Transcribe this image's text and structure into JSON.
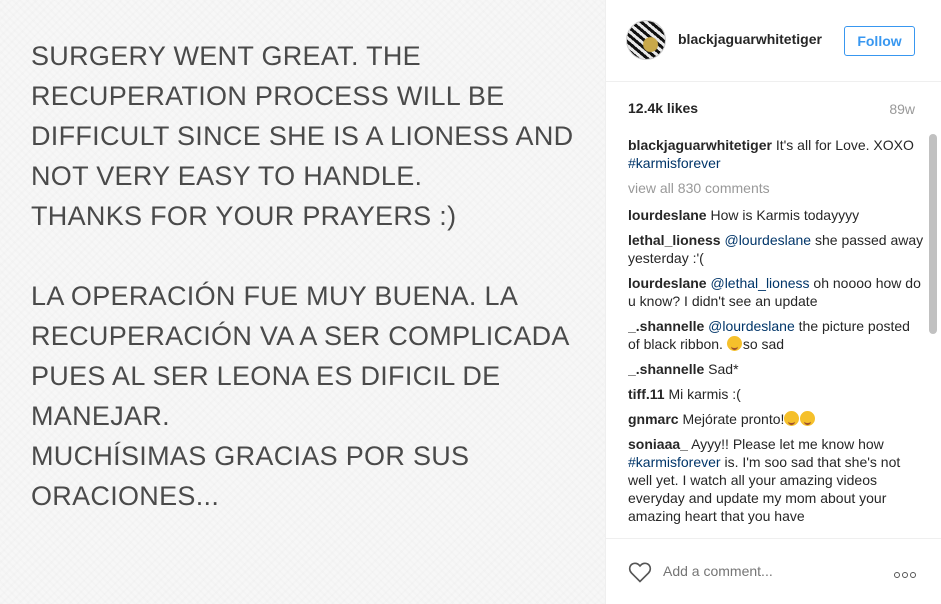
{
  "photo": {
    "lines": [
      "SURGERY WENT GREAT. THE",
      "RECUPERATION PROCESS WILL BE",
      "DIFFICULT SINCE SHE IS A LIONESS AND",
      "NOT VERY EASY TO HANDLE.",
      "THANKS FOR YOUR PRAYERS :)",
      "LA OPERACIÓN FUE MUY BUENA. LA",
      "RECUPERACIÓN VA A SER COMPLICADA",
      "PUES AL SER LEONA ES DIFICIL DE",
      "MANEJAR.",
      "MUCHÍSIMAS GRACIAS POR SUS",
      "ORACIONES..."
    ]
  },
  "header": {
    "username": "blackjaguarwhitetiger",
    "follow_label": "Follow"
  },
  "stats": {
    "likes": "12.4k likes",
    "time": "89w"
  },
  "caption": {
    "user": "blackjaguarwhitetiger",
    "text": "It's all for Love. XOXO",
    "hashtag": "#karmisforever"
  },
  "view_all": "view all 830 comments",
  "comments": [
    {
      "user": "lourdeslane",
      "text": "How is Karmis todayyyy"
    },
    {
      "user": "lethal_lioness",
      "mention": "@lourdeslane",
      "text": "she passed away yesterday :'("
    },
    {
      "user": "lourdeslane",
      "mention": "@lethal_lioness",
      "text": "oh noooo how do u know? I didn't see an update"
    },
    {
      "user": "_.shannelle",
      "mention": "@lourdeslane",
      "text": "the picture posted of black ribbon.",
      "text_after": "so sad"
    },
    {
      "user": "_.shannelle",
      "text": "Sad*"
    },
    {
      "user": "tiff.11",
      "text": "Mi karmis :("
    },
    {
      "user": "gnmarc",
      "text": "Mejórate pronto!"
    },
    {
      "user": "soniaaa_",
      "text": "Ayyy!! Please let me know how",
      "hashtag": "#karmisforever",
      "text_after": "is. I'm soo sad that she's not well yet. I watch all your amazing videos everyday and update my mom about your amazing heart that you have"
    }
  ],
  "footer": {
    "add_comment_placeholder": "Add a comment...",
    "heart_icon": "heart-outline-icon",
    "more_icon": "more-options-icon"
  },
  "colors": {
    "accent": "#3897f0",
    "link": "#003569",
    "muted": "#999999"
  }
}
